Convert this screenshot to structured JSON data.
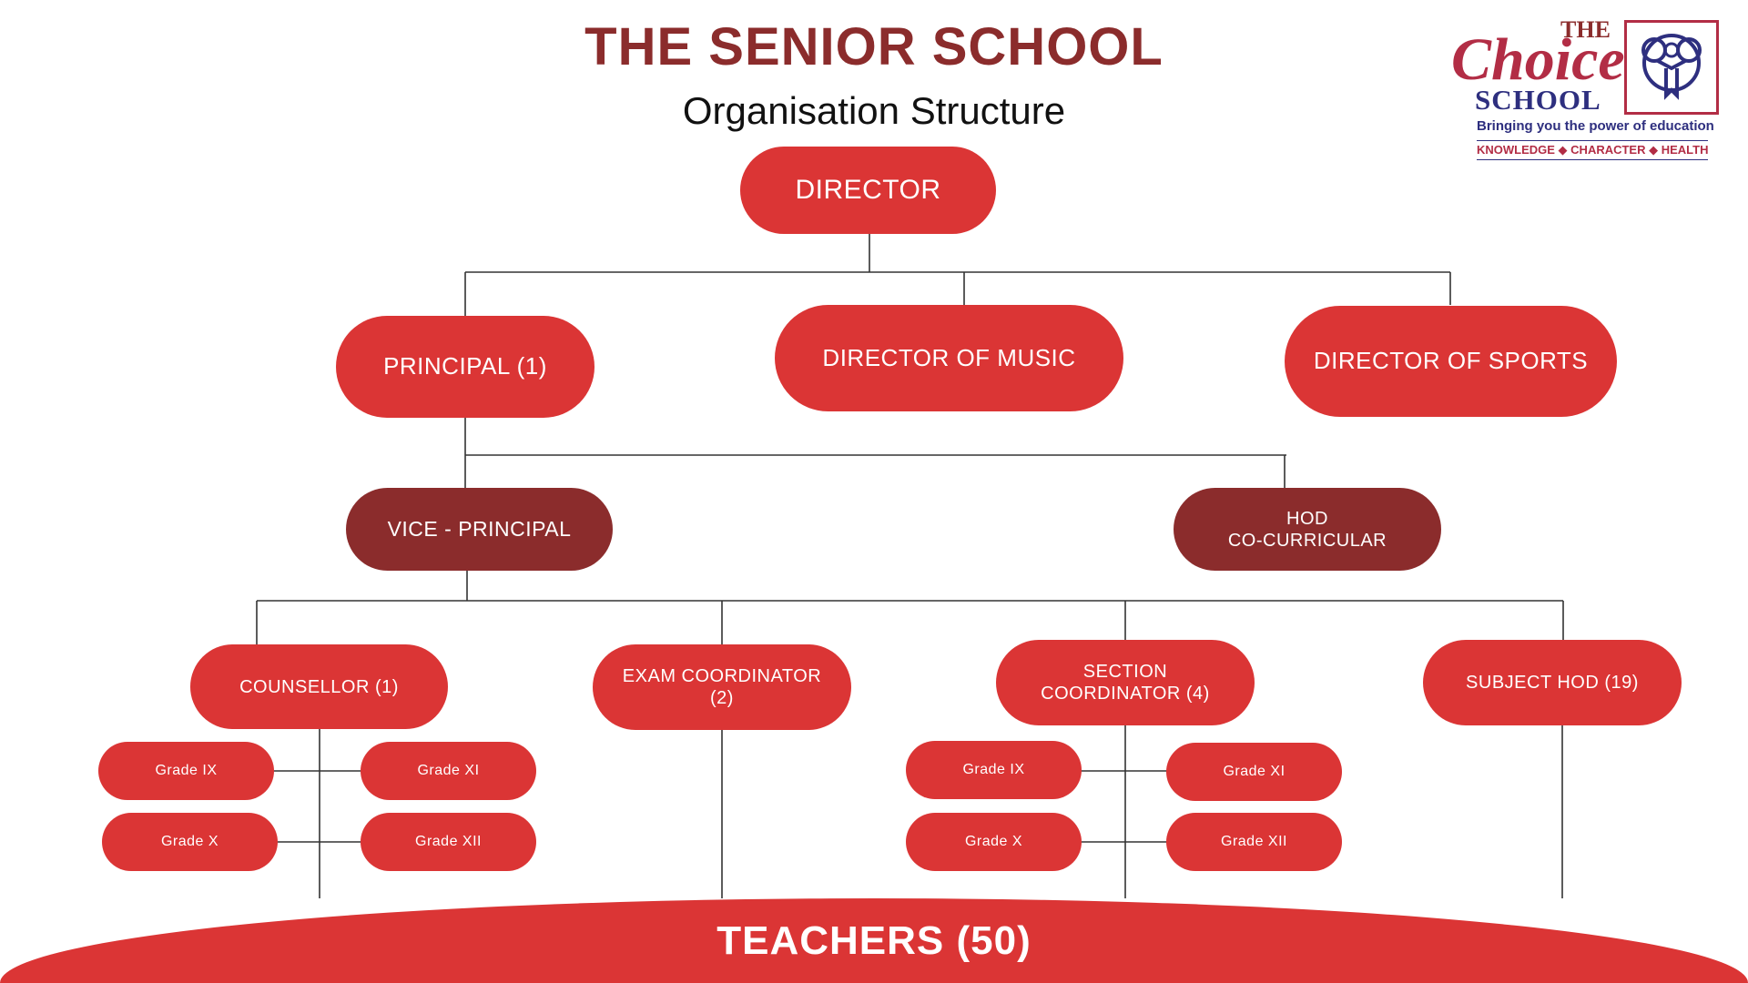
{
  "header": {
    "title": "THE SENIOR SCHOOL",
    "subtitle": "Organisation Structure"
  },
  "logo": {
    "the": "THE",
    "choice": "Choice",
    "school": "SCHOOL",
    "tagline": "Bringing  you the power of education",
    "values": "KNOWLEDGE ◆ CHARACTER ◆ HEALTH"
  },
  "nodes": {
    "director": "DIRECTOR",
    "principal": "PRINCIPAL (1)",
    "director_music": "DIRECTOR  OF MUSIC",
    "director_sports": "DIRECTOR OF SPORTS",
    "vice_principal": "VICE - PRINCIPAL",
    "hod_cocurricular": "HOD\nCO-CURRICULAR",
    "counsellor": "COUNSELLOR (1)",
    "exam_coordinator": "EXAM COORDINATOR\n(2)",
    "section_coordinator": "SECTION\nCOORDINATOR (4)",
    "subject_hod": "SUBJECT HOD (19)",
    "c_grade_ix": "Grade IX",
    "c_grade_xi": "Grade XI",
    "c_grade_x": "Grade X",
    "c_grade_xii": "Grade XII",
    "s_grade_ix": "Grade IX",
    "s_grade_xi": "Grade XI",
    "s_grade_x": "Grade X",
    "s_grade_xii": "Grade XII"
  },
  "footer": {
    "teachers": "TEACHERS (50)"
  },
  "colors": {
    "red": "#DB3535",
    "maroon": "#8B2C2C",
    "logo_blue": "#2E2F7F",
    "logo_pink": "#B22D45"
  }
}
